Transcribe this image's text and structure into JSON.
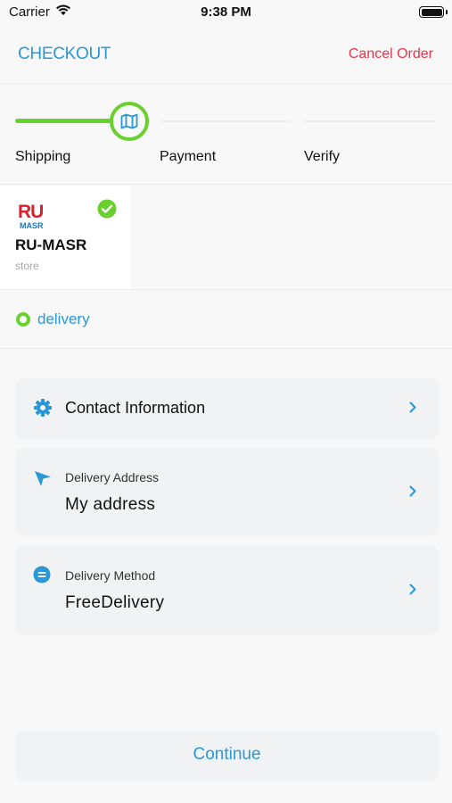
{
  "status_bar": {
    "carrier": "Carrier",
    "time": "9:38 PM",
    "battery_level": 1.0
  },
  "nav": {
    "title": "CHECKOUT",
    "cancel_label": "Cancel Order"
  },
  "stepper": {
    "current_step": 0,
    "current_step_icon": "map-icon",
    "steps": [
      {
        "label": "Shipping"
      },
      {
        "label": "Payment"
      },
      {
        "label": "Verify"
      }
    ]
  },
  "store": {
    "logo_text_top": "RU",
    "logo_text_bottom": "MASR",
    "name": "RU-MASR",
    "type": "store",
    "selected": true
  },
  "fulfillment": {
    "option_label": "delivery",
    "selected": true
  },
  "cards": {
    "contact": {
      "icon": "gear-icon",
      "title": "Contact Information"
    },
    "address": {
      "icon": "location-arrow-icon",
      "subtitle": "Delivery Address",
      "value": "My address"
    },
    "method": {
      "icon": "list-circle-icon",
      "subtitle": "Delivery Method",
      "value": "FreeDelivery"
    }
  },
  "continue_label": "Continue",
  "colors": {
    "accent_blue": "#2a97d6",
    "accent_green": "#6ad02d",
    "cancel_red": "#e8354a",
    "logo_red": "#d8232f",
    "logo_blue": "#1f75c0"
  }
}
